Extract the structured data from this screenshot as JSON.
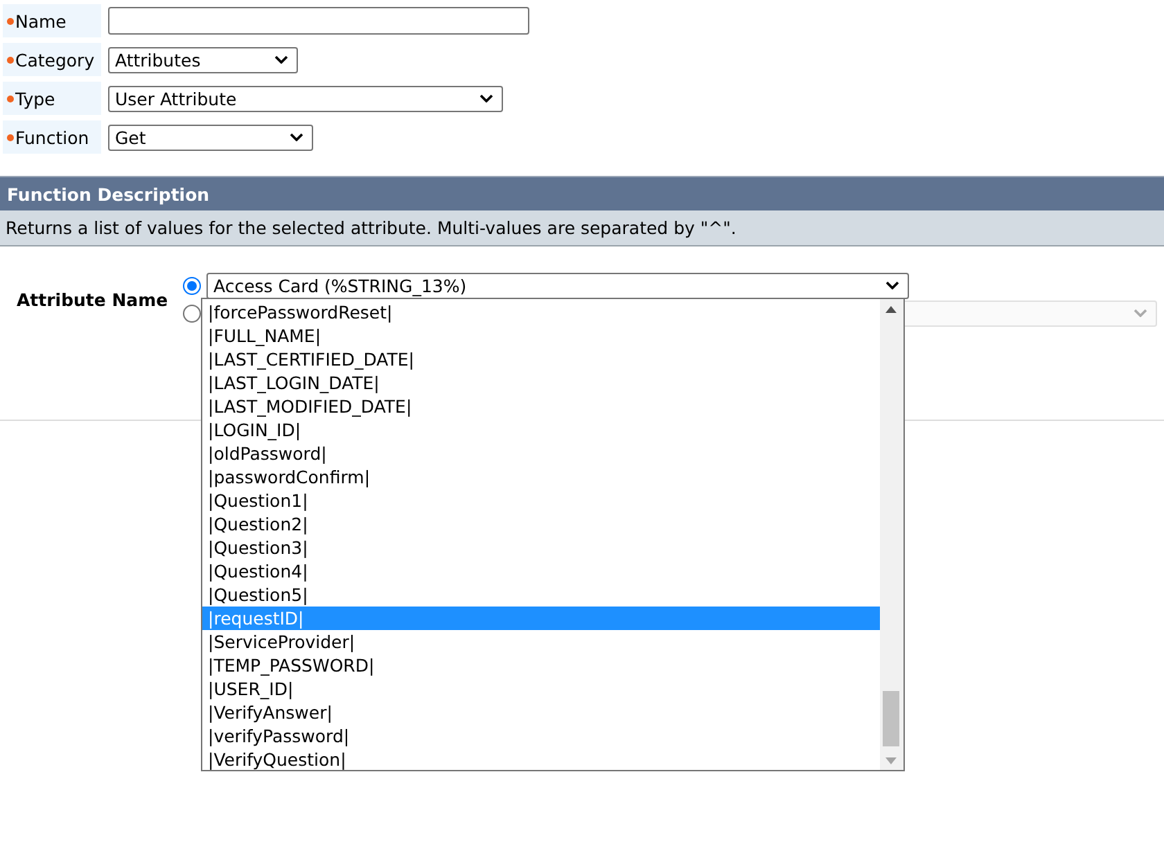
{
  "form_fields": [
    {
      "label": "Name",
      "required": true,
      "kind": "text"
    },
    {
      "label": "Category",
      "required": true,
      "kind": "select",
      "value": "Attributes"
    },
    {
      "label": "Type",
      "required": true,
      "kind": "select",
      "value": "User Attribute"
    },
    {
      "label": "Function",
      "required": true,
      "kind": "select",
      "value": "Get"
    }
  ],
  "function_description": {
    "title": "Function Description",
    "text": "Returns a list of values for the selected attribute. Multi-values are separated by \"^\"."
  },
  "attribute_name": {
    "label": "Attribute Name",
    "sources": [
      {
        "selected": true,
        "kind": "select",
        "value": "Access Card (%STRING_13%)",
        "expanded": true,
        "options": [
          {
            "label": "|forcePasswordReset|",
            "selected": false
          },
          {
            "label": "|FULL_NAME|",
            "selected": false
          },
          {
            "label": "|LAST_CERTIFIED_DATE|",
            "selected": false
          },
          {
            "label": "|LAST_LOGIN_DATE|",
            "selected": false
          },
          {
            "label": "|LAST_MODIFIED_DATE|",
            "selected": false
          },
          {
            "label": "|LOGIN_ID|",
            "selected": false
          },
          {
            "label": "|oldPassword|",
            "selected": false
          },
          {
            "label": "|passwordConfirm|",
            "selected": false
          },
          {
            "label": "|Question1|",
            "selected": false
          },
          {
            "label": "|Question2|",
            "selected": false
          },
          {
            "label": "|Question3|",
            "selected": false
          },
          {
            "label": "|Question4|",
            "selected": false
          },
          {
            "label": "|Question5|",
            "selected": false
          },
          {
            "label": "|requestID|",
            "selected": true
          },
          {
            "label": "|ServiceProvider|",
            "selected": false
          },
          {
            "label": "|TEMP_PASSWORD|",
            "selected": false
          },
          {
            "label": "|USER_ID|",
            "selected": false
          },
          {
            "label": "|VerifyAnswer|",
            "selected": false
          },
          {
            "label": "|verifyPassword|",
            "selected": false
          },
          {
            "label": "|VerifyQuestion|",
            "selected": false
          }
        ]
      },
      {
        "selected": false,
        "kind": "select",
        "disabled": true
      }
    ]
  }
}
